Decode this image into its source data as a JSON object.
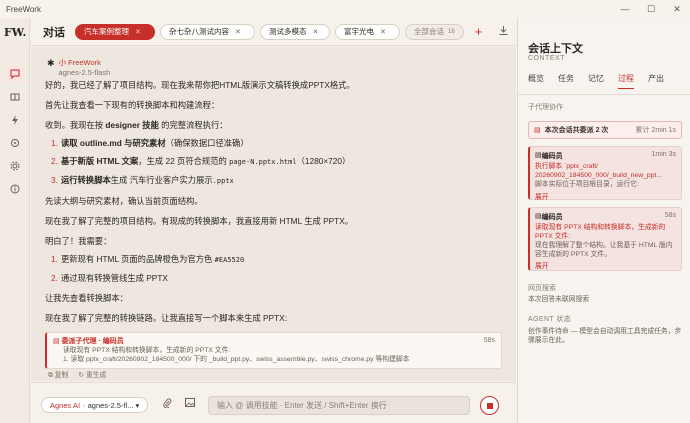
{
  "app": {
    "title": "FreeWork",
    "logo": "FW."
  },
  "window_controls": [
    "—",
    "☐",
    "✕"
  ],
  "header": {
    "title": "对话",
    "tabs": [
      {
        "label": "汽车案例整理",
        "active": true
      },
      {
        "label": "杂七杂八测试内容",
        "active": false
      },
      {
        "label": "测试多模态",
        "active": false
      },
      {
        "label": "富宇光电",
        "active": false
      }
    ],
    "all_label": "全部会话",
    "all_count": "16"
  },
  "message": {
    "sender": "小 FreeWork",
    "model": "agnes-2.5-flash",
    "p1": "好的，我已经了解了项目结构。现在我来帮你把HTML版演示文稿转换成PPTX格式。",
    "p2": "首先让我查看一下现有的转换脚本和构建流程：",
    "p3_pre": "收到。我现在按 ",
    "p3_bold": "designer 技能",
    "p3_post": " 的完整流程执行：",
    "steps": [
      {
        "n": "1.",
        "bold": "读取 outline.md 与研究素材",
        "rest": "（确保数据口径准确）",
        "code": "",
        "tail": ""
      },
      {
        "n": "2.",
        "bold": "基于新版 HTML 文案",
        "rest": "，生成 22 页符合规范的 ",
        "code": "page-N.pptx.html",
        "tail": "（1280×720）"
      },
      {
        "n": "3.",
        "bold": "运行转换脚本",
        "rest": "生成 汽车行业客户实力展示",
        "code": ".pptx",
        "tail": ""
      }
    ],
    "p4": "先读大纲与研究素材，确认当前页面结构。",
    "p5": "现在我了解了完整的项目结构。有现成的转换脚本，我直接用新 HTML 生成 PPTX。",
    "p6": "明白了！我需要：",
    "steps2": [
      {
        "n": "1.",
        "text": "更新现有 HTML 页面的品牌橙色为官方色 ",
        "code": "#EA5520"
      },
      {
        "n": "2.",
        "text": "通过现有转换管线生成 PPTX",
        "code": ""
      }
    ],
    "p7": "让我先查看转换脚本：",
    "p8": "现在我了解了完整的转换链路。让我直接写一个脚本来生成 PPTX:"
  },
  "subagent": {
    "title": "委派子代理 · 编码员",
    "duration": "58s",
    "line1": "读取现有 PPTX 结构和转换脚本，生成新的 PPTX 文件:",
    "line2": "1. 读取 pptx_craft/20260902_184500_000/ 下的 _build_ppt.py、swiss_assemble.py、swiss_chrome.py 等构建脚本"
  },
  "actions": {
    "copy": "复制",
    "regen": "重生成"
  },
  "input": {
    "model_prefix": "Agnes AI",
    "model_rest": "· agnes-2.5-fl... ▾",
    "placeholder": "输入 @ 调用技能 · Enter 发送 / Shift+Enter 换行"
  },
  "context": {
    "title": "会话上下文",
    "subtitle": "CONTEXT",
    "tabs": [
      {
        "label": "概览",
        "active": false
      },
      {
        "label": "任务",
        "active": false
      },
      {
        "label": "记忆",
        "active": false
      },
      {
        "label": "过程",
        "active": true
      },
      {
        "label": "产出",
        "active": false
      }
    ],
    "section_sub": "子代理协作",
    "summary_label": "本次会话共委派 2 次",
    "summary_time": "累计 2min 1s",
    "agents": [
      {
        "name": "编码员",
        "time": "1min 3s",
        "task": "执行脚本 `pptx_craft/ 20260902_184500_000/_build_new_ppt...",
        "desc": "脚本实际位于项目根目录，运行它:",
        "more": "展开"
      },
      {
        "name": "编码员",
        "time": "58s",
        "task": "读取现有 PPTX 结构和转换脚本，生成新的 PPTX 文件:",
        "desc": "现在我理解了整个结构。让我基于 HTML 版内容生成新的 PPTX 文件。",
        "more": "展开"
      }
    ],
    "web_title": "网页搜索",
    "web_text": "本次回答未联网搜索",
    "agent_state_title": "AGENT 状态",
    "agent_state_text": "创作事件待命 — 模型会自动调用工具完成任务，步骤展示在此。"
  },
  "colors": {
    "accent": "#c62f2a",
    "background": "#ede7df"
  }
}
